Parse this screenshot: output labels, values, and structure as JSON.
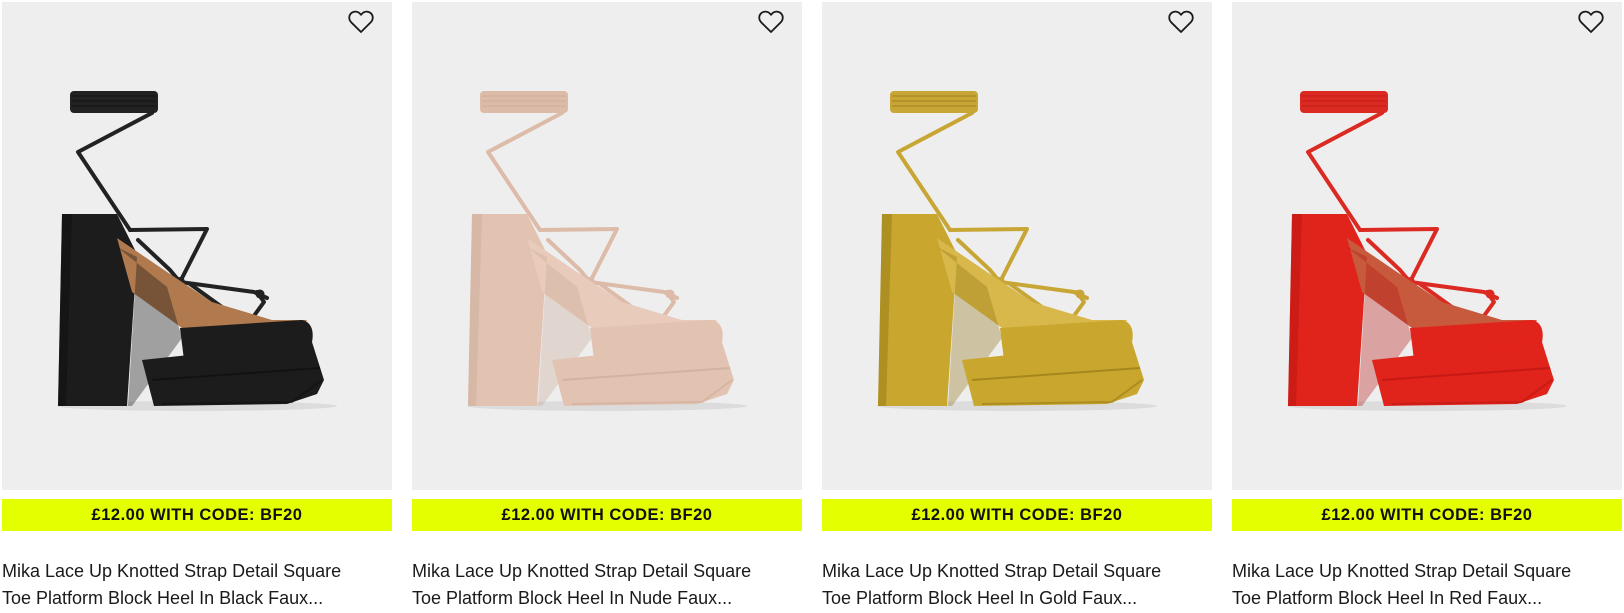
{
  "products": [
    {
      "promo": "£12.00 WITH CODE: BF20",
      "title_line1": "Mika Lace Up Knotted Strap Detail Square",
      "title_line2": "Toe Platform Block Heel In Black Faux...",
      "colors": {
        "main": "#1c1c1c",
        "shade": "#0d0d0d",
        "strap": "#222222",
        "insole": "#b07a4e"
      }
    },
    {
      "promo": "£12.00 WITH CODE: BF20",
      "title_line1": "Mika Lace Up Knotted Strap Detail Square",
      "title_line2": "Toe Platform Block Heel In Nude Faux...",
      "colors": {
        "main": "#e2c3b2",
        "shade": "#c9a896",
        "strap": "#dcbba9",
        "insole": "#e8cbbb"
      }
    },
    {
      "promo": "£12.00 WITH CODE: BF20",
      "title_line1": "Mika Lace Up Knotted Strap Detail Square",
      "title_line2": "Toe Platform Block Heel In Gold Faux...",
      "colors": {
        "main": "#c9a62d",
        "shade": "#8f7414",
        "strap": "#c8a636",
        "insole": "#d8b84a"
      }
    },
    {
      "promo": "£12.00 WITH CODE: BF20",
      "title_line1": "Mika Lace Up Knotted Strap Detail Square",
      "title_line2": "Toe Platform Block Heel In Red Faux...",
      "colors": {
        "main": "#e0231b",
        "shade": "#b51410",
        "strap": "#db2a22",
        "insole": "#c75a3c"
      }
    }
  ],
  "icons": {
    "wishlist": "heart-outline-icon"
  },
  "accent_color": "#e4ff00"
}
